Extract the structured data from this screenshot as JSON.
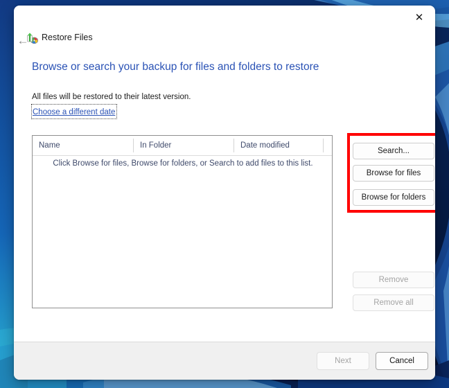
{
  "window": {
    "app_title": "Restore Files",
    "app_icon": "restore-files-icon",
    "close_label": "✕",
    "back_label": "←"
  },
  "content": {
    "heading": "Browse or search your backup for files and folders to restore",
    "subtext": "All files will be restored to their latest version.",
    "date_link": "Choose a different date"
  },
  "list": {
    "columns": [
      "Name",
      "In Folder",
      "Date modified"
    ],
    "empty_message": "Click Browse for files, Browse for folders, or Search to add files to this list.",
    "rows": []
  },
  "actions": {
    "search": "Search...",
    "browse_files": "Browse for files",
    "browse_folders": "Browse for folders",
    "remove": "Remove",
    "remove_all": "Remove all"
  },
  "footer": {
    "next": "Next",
    "cancel": "Cancel"
  },
  "annotation": {
    "highlight_color": "#ff0000"
  }
}
